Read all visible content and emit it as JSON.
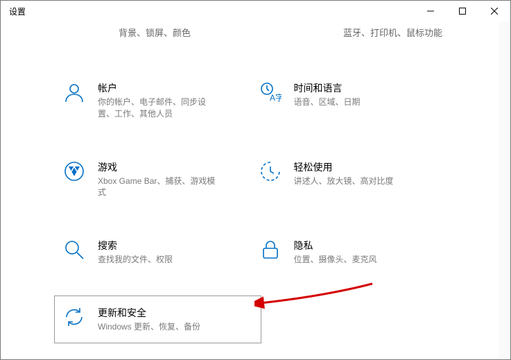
{
  "window": {
    "title": "设置"
  },
  "trunc_left": "背景、锁屏、颜色",
  "trunc_right": "蓝牙、打印机、鼠标功能",
  "tiles": {
    "accounts": {
      "title": "帐户",
      "desc": "你的帐户、电子邮件、同步设置、工作、其他人员"
    },
    "timelang": {
      "title": "时间和语言",
      "desc": "语音、区域、日期"
    },
    "gaming": {
      "title": "游戏",
      "desc": "Xbox Game Bar、捕获、游戏模式"
    },
    "ease": {
      "title": "轻松使用",
      "desc": "讲述人、放大镜、高对比度"
    },
    "search": {
      "title": "搜索",
      "desc": "查找我的文件、权限"
    },
    "privacy": {
      "title": "隐私",
      "desc": "位置、摄像头、麦克风"
    },
    "update": {
      "title": "更新和安全",
      "desc": "Windows 更新、恢复、备份"
    }
  }
}
